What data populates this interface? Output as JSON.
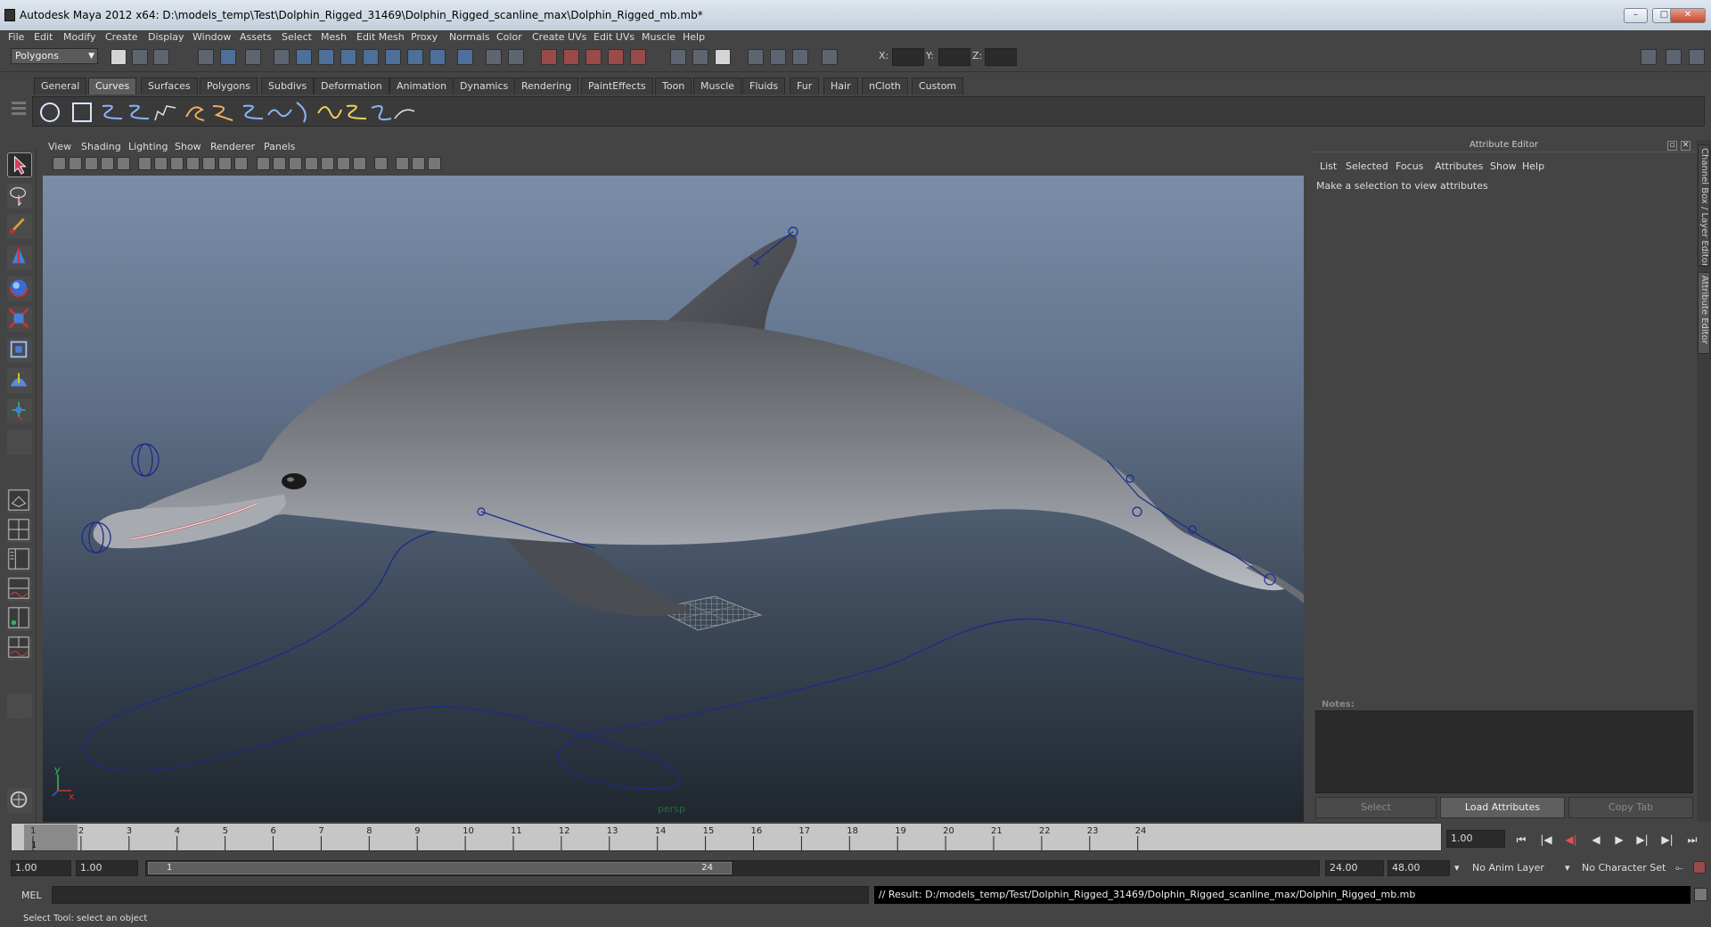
{
  "window": {
    "title": "Autodesk Maya 2012 x64: D:\\models_temp\\Test\\Dolphin_Rigged_31469\\Dolphin_Rigged_scanline_max\\Dolphin_Rigged_mb.mb*",
    "controls": [
      "–",
      "□",
      "✕"
    ]
  },
  "menubar": [
    "File",
    "Edit",
    "Modify",
    "Create",
    "Display",
    "Window",
    "Assets",
    "Select",
    "Mesh",
    "Edit Mesh",
    "Proxy",
    "Normals",
    "Color",
    "Create UVs",
    "Edit UVs",
    "Muscle",
    "Help"
  ],
  "status_line": {
    "mode": "Polygons",
    "x_label": "X:",
    "y_label": "Y:",
    "z_label": "Z:"
  },
  "shelf": {
    "tabs": [
      "General",
      "Curves",
      "Surfaces",
      "Polygons",
      "Subdivs",
      "Deformation",
      "Animation",
      "Dynamics",
      "Rendering",
      "PaintEffects",
      "Toon",
      "Muscle",
      "Fluids",
      "Fur",
      "Hair",
      "nCloth",
      "Custom"
    ],
    "active_tab": "Curves",
    "icons": [
      "nurbs-circle-icon",
      "nurbs-square-icon",
      "cv-curve-icon",
      "ep-curve-icon",
      "pencil-curve-icon",
      "arc-3pt-icon",
      "arc-2pt-icon",
      "attach-curves-icon",
      "detach-curves-icon",
      "insert-knot-icon",
      "extend-curve-icon",
      "offset-curve-icon",
      "rebuild-curve-icon",
      "add-points-icon",
      "curve-editing-tool-icon"
    ]
  },
  "viewport": {
    "menu": [
      "View",
      "Shading",
      "Lighting",
      "Show",
      "Renderer",
      "Panels"
    ],
    "camera_label": "persp",
    "axis_x": "x",
    "axis_y": "y"
  },
  "attribute_editor": {
    "title": "Attribute Editor",
    "menu": [
      "List",
      "Selected",
      "Focus",
      "Attributes",
      "Show",
      "Help"
    ],
    "message": "Make a selection to view attributes",
    "notes_label": "Notes:",
    "buttons": [
      "Select",
      "Load Attributes",
      "Copy Tab"
    ]
  },
  "side_tabs": [
    "Channel Box / Layer Editor",
    "Attribute Editor"
  ],
  "time_slider": {
    "ticks": [
      "1",
      "2",
      "3",
      "4",
      "5",
      "6",
      "7",
      "8",
      "9",
      "10",
      "11",
      "12",
      "13",
      "14",
      "15",
      "16",
      "17",
      "18",
      "19",
      "20",
      "21",
      "22",
      "23",
      "24"
    ],
    "current_frame": "1",
    "current_time_field": "1.00"
  },
  "range_slider": {
    "start_time": "1.00",
    "playback_start": "1.00",
    "handle_start": "1",
    "handle_end": "24",
    "playback_end": "24.00",
    "end_time": "48.00",
    "anim_layer": "No Anim Layer",
    "character_set": "No Character Set"
  },
  "command_line": {
    "label": "MEL",
    "result": "// Result: D:/models_temp/Test/Dolphin_Rigged_31469/Dolphin_Rigged_scanline_max/Dolphin_Rigged_mb.mb"
  },
  "help_line": "Select Tool: select an object",
  "colors": {
    "ui_bg": "#444444",
    "viewport_top": "#7b8ea8",
    "viewport_bottom": "#1f262e",
    "control_curve": "#1c2a8c",
    "dolphin_skin": "#7c7f84"
  }
}
